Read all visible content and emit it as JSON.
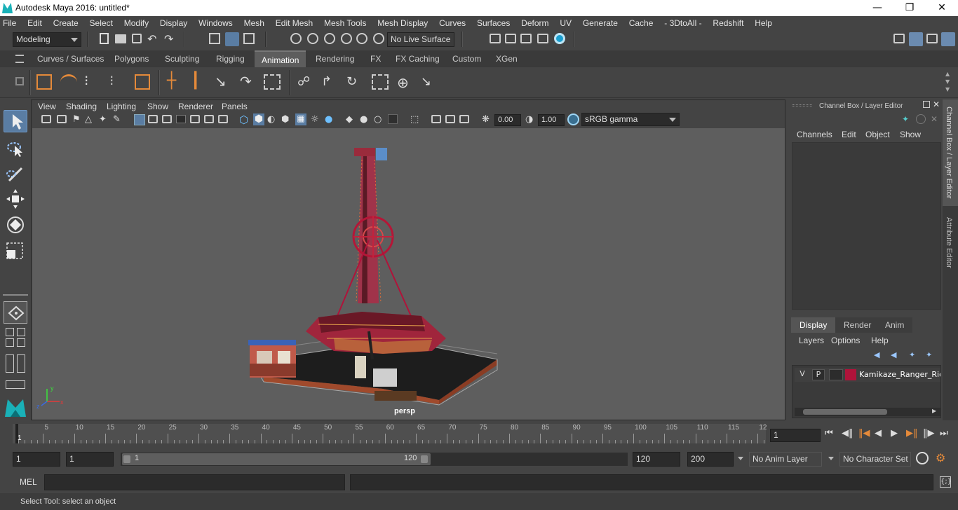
{
  "window": {
    "title": "Autodesk Maya 2016: untitled*"
  },
  "menubar": [
    "File",
    "Edit",
    "Create",
    "Select",
    "Modify",
    "Display",
    "Windows",
    "Mesh",
    "Edit Mesh",
    "Mesh Tools",
    "Mesh Display",
    "Curves",
    "Surfaces",
    "Deform",
    "UV",
    "Generate",
    "Cache",
    "- 3DtoAll -",
    "Redshift",
    "Help"
  ],
  "statusline": {
    "mode": "Modeling",
    "live_surface": "No Live Surface"
  },
  "shelf": {
    "tabs": [
      "Curves / Surfaces",
      "Polygons",
      "Sculpting",
      "Rigging",
      "Animation",
      "Rendering",
      "FX",
      "FX Caching",
      "Custom",
      "XGen"
    ],
    "active_tab": "Animation"
  },
  "viewport": {
    "menu": [
      "View",
      "Shading",
      "Lighting",
      "Show",
      "Renderer",
      "Panels"
    ],
    "exposure": "0.00",
    "gamma": "1.00",
    "color_space": "sRGB gamma",
    "camera": "persp"
  },
  "channelbox": {
    "title": "Channel Box / Layer Editor",
    "menu": [
      "Channels",
      "Edit",
      "Object",
      "Show"
    ],
    "layer_tabs": [
      "Display",
      "Render",
      "Anim"
    ],
    "active_layer_tab": "Display",
    "layer_menu": [
      "Layers",
      "Options",
      "Help"
    ],
    "layer": {
      "v": "V",
      "p": "P",
      "name": "Kamikaze_Ranger_Ride",
      "color": "#b0133a"
    }
  },
  "sidetabs": [
    "Channel Box / Layer Editor",
    "Attribute Editor"
  ],
  "timeline": {
    "labels": [
      "5",
      "10",
      "15",
      "20",
      "25",
      "30",
      "35",
      "40",
      "45",
      "50",
      "55",
      "60",
      "65",
      "70",
      "75",
      "80",
      "85",
      "90",
      "95",
      "100",
      "105",
      "110",
      "115",
      "12"
    ],
    "start_label": "1",
    "current_frame": "1"
  },
  "range": {
    "start": "1",
    "playback_start": "1",
    "slider_start": "1",
    "slider_end": "120",
    "playback_end": "120",
    "end": "200",
    "anim_layer": "No Anim Layer",
    "character_set": "No Character Set"
  },
  "cmdline": {
    "label": "MEL"
  },
  "helpline": {
    "text": "Select Tool: select an object"
  },
  "colors": {
    "accent": "#5a7da3",
    "active_tab": "#5d5d5d",
    "model": "#b0133a"
  }
}
